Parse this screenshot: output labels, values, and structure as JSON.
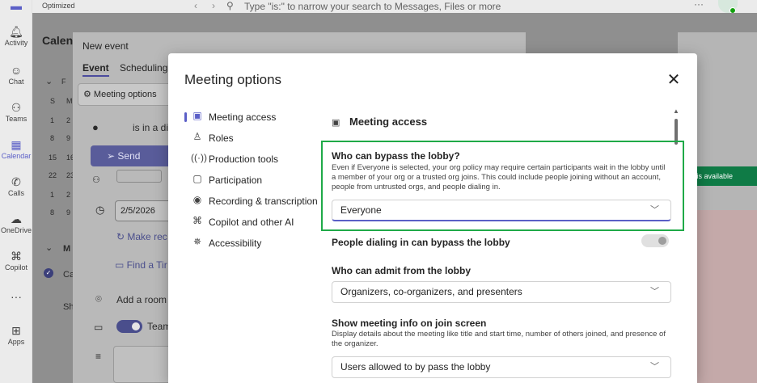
{
  "topbar": {
    "optimized": "Optimized",
    "back_arrow": "‹",
    "forward_arrow": "›",
    "search_placeholder": "Type \"is:\" to narrow your search to Messages, Files or more",
    "more": "···"
  },
  "rail": {
    "items": [
      {
        "label": "Activity",
        "icon": "bell-icon"
      },
      {
        "label": "Chat",
        "icon": "chat-icon"
      },
      {
        "label": "Teams",
        "icon": "teams-icon"
      },
      {
        "label": "Calendar",
        "icon": "calendar-icon"
      },
      {
        "label": "Calls",
        "icon": "phone-icon"
      },
      {
        "label": "OneDrive",
        "icon": "cloud-icon"
      },
      {
        "label": "Copilot",
        "icon": "copilot-icon"
      },
      {
        "label": "Apps",
        "icon": "apps-icon"
      }
    ],
    "more": "···"
  },
  "calendar": {
    "title": "Calen",
    "left_labels": [
      "F",
      "S",
      "M",
      "1",
      "2",
      "8",
      "9",
      "15",
      "16",
      "22",
      "23",
      "1",
      "2",
      "8",
      "9",
      "M",
      "Ca",
      "Sh"
    ],
    "available": "e is available"
  },
  "event": {
    "title": "New event",
    "tab_event": "Event",
    "tab_scheduling": "Scheduling",
    "meeting_options": "Meeting options",
    "status_text": "is in a di",
    "send": "Send",
    "date": "2/5/2026",
    "make_recurring": "Make rec",
    "find_time": "Find a Tir",
    "add_room": "Add a room",
    "teams": "Team"
  },
  "dialog": {
    "title": "Meeting options",
    "close": "✕",
    "nav": [
      {
        "label": "Meeting access",
        "icon": "lobby-icon",
        "selected": true
      },
      {
        "label": "Roles",
        "icon": "person-icon"
      },
      {
        "label": "Production tools",
        "icon": "broadcast-icon"
      },
      {
        "label": "Participation",
        "icon": "chat-bubble-icon"
      },
      {
        "label": "Recording & transcription",
        "icon": "record-icon"
      },
      {
        "label": "Copilot and other AI",
        "icon": "copilot-icon"
      },
      {
        "label": "Accessibility",
        "icon": "accessibility-icon"
      }
    ],
    "section_title": "Meeting access",
    "lobby_bypass": {
      "label": "Who can bypass the lobby?",
      "description": "Even if Everyone is selected, your org policy may require certain participants wait in the lobby until a member of your org or a trusted org joins. This could include people joining without an account, people from untrusted orgs, and people dialing in.",
      "value": "Everyone"
    },
    "dialin_bypass": {
      "label": "People dialing in can bypass the lobby",
      "enabled": false
    },
    "admit_from_lobby": {
      "label": "Who can admit from the lobby",
      "value": "Organizers, co-organizers, and presenters"
    },
    "join_screen_info": {
      "label": "Show meeting info on join screen",
      "description": "Display details about the meeting like title and start time, number of others joined, and presence of the organizer.",
      "value": "Users allowed to by pass the lobby"
    }
  },
  "colors": {
    "accent": "#5b5fc7",
    "highlight": "#1faa48",
    "available_badge": "#0f7b46"
  }
}
